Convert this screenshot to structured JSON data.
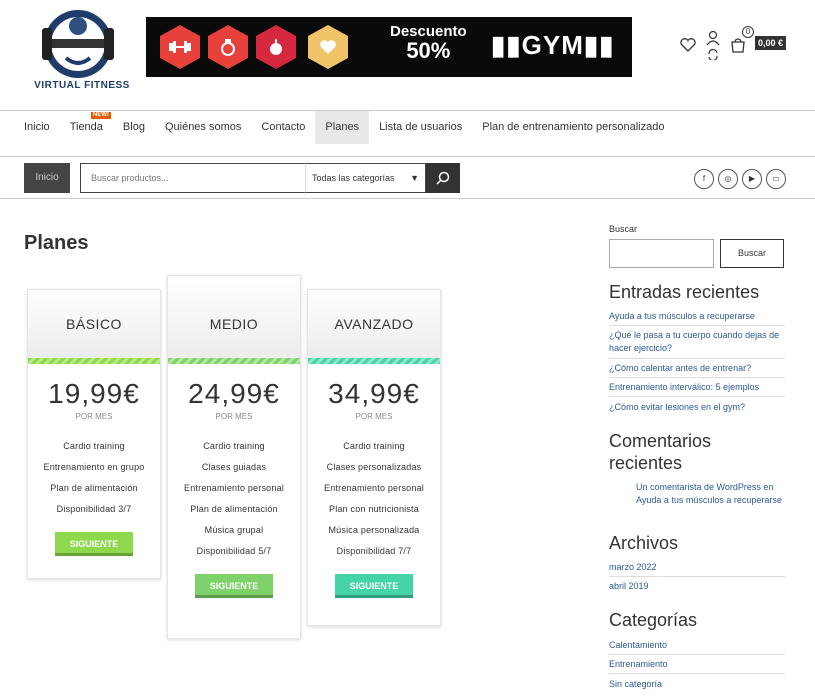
{
  "header": {
    "logo_text": "VIRTUAL FITNESS",
    "banner": {
      "discount_line1": "Descuento",
      "discount_line2": "50%",
      "gym_text": "GYM",
      "hex_colors": [
        "#e8403a",
        "#e8403a",
        "#d6293f",
        "#f2c46a"
      ]
    },
    "icons": [
      "heart-icon",
      "user-icon",
      "refresh-icon",
      "cart-icon"
    ],
    "cart_count": "0",
    "cart_total": "0,00 €"
  },
  "nav": {
    "items": [
      {
        "label": "Inicio"
      },
      {
        "label": "Tienda",
        "badge": "NEW!"
      },
      {
        "label": "Blog"
      },
      {
        "label": "Quiénes somos"
      },
      {
        "label": "Contacto"
      },
      {
        "label": "Planes",
        "active": true
      },
      {
        "label": "Lista de usuarios"
      },
      {
        "label": "Plan de entrenamiento personalizado"
      }
    ]
  },
  "search": {
    "home_label": "Inicio",
    "placeholder": "Buscar productos...",
    "category_selected": "Todas las categorías",
    "socials": [
      "facebook-icon",
      "instagram-icon",
      "youtube-icon",
      "shop-icon"
    ]
  },
  "main": {
    "title": "Planes",
    "plans": [
      {
        "name": "BÁSICO",
        "price": "19,99€",
        "period": "POR MES",
        "features": [
          "Cardio training",
          "Entrenamiento en grupo",
          "Plan de alimentación",
          "Disponibilidad 3/7"
        ],
        "button": "SIGUIENTE",
        "accent": "#8dd84c"
      },
      {
        "name": "MEDIO",
        "price": "24,99€",
        "period": "POR MES",
        "features": [
          "Cardio training",
          "Clases guiadas",
          "Entrenamiento personal",
          "Plan de alimentación",
          "Música grupal",
          "Disponibilidad 5/7"
        ],
        "button": "SIGUIENTE",
        "accent": "#7fd26a"
      },
      {
        "name": "AVANZADO",
        "price": "34,99€",
        "period": "POR MES",
        "features": [
          "Cardio training",
          "Clases personalizadas",
          "Entrenamiento personal",
          "Plan con nutricionista",
          "Música personalizada",
          "Disponibilidad 7/7"
        ],
        "button": "SIGUIENTE",
        "accent": "#45d3a8"
      }
    ]
  },
  "sidebar": {
    "search_label": "Buscar",
    "search_button": "Buscar",
    "recent_posts_title": "Entradas recientes",
    "recent_posts": [
      "Ayuda a tus músculos a recuperarse",
      "¿Qué le pasa a tu cuerpo cuando dejas de hacer ejercicio?",
      "¿Cómo calentar antes de entrenar?",
      "Entrenamiento interválico: 5 ejemplos",
      "¿Cómo evitar lesiones en el gym?"
    ],
    "recent_comments_title_1": "Comentarios",
    "recent_comments_title_2": "recientes",
    "recent_comment": "Un comentarista de WordPress en Ayuda a tus músculos a recuperarse",
    "archives_title": "Archivos",
    "archives": [
      "marzo 2022",
      "abril 2019"
    ],
    "categories_title": "Categorías",
    "categories": [
      "Calentamiento",
      "Entrenamiento",
      "Sin categoría"
    ]
  }
}
